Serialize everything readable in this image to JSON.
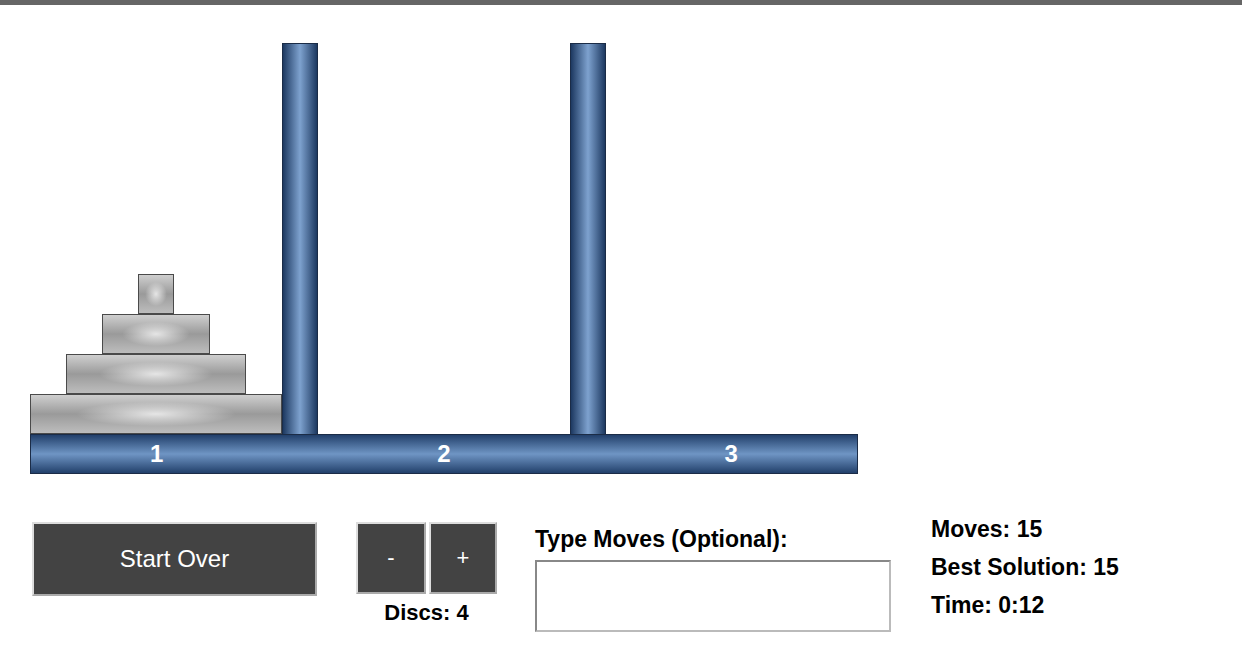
{
  "pegs": [
    {
      "label": "1",
      "discs": [
        {
          "size": 4
        },
        {
          "size": 3
        },
        {
          "size": 2
        },
        {
          "size": 1
        }
      ]
    },
    {
      "label": "2",
      "discs": []
    },
    {
      "label": "3",
      "discs": []
    }
  ],
  "buttons": {
    "start_over": "Start Over",
    "minus": "-",
    "plus": "+"
  },
  "discs_label": "Discs: 4",
  "moves_input": {
    "label": "Type Moves (Optional):",
    "value": ""
  },
  "stats": [
    "Moves: 15",
    "Best Solution: 15",
    "Time: 0:12"
  ]
}
